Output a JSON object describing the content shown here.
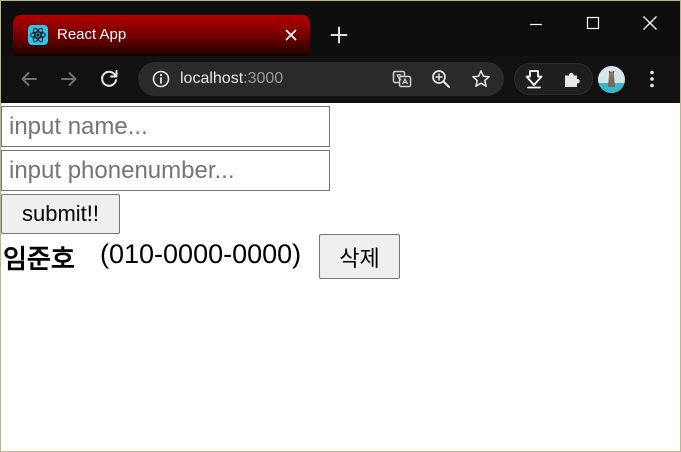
{
  "browser": {
    "tab": {
      "title": "React App",
      "favicon": "react-logo-icon"
    },
    "url": {
      "host": "localhost",
      "port": ":3000"
    },
    "accent": "#b30000",
    "toolbar_icons": [
      "back-arrow-icon",
      "forward-arrow-icon",
      "reload-icon",
      "site-info-icon",
      "translate-icon",
      "zoom-icon",
      "bookmark-star-icon",
      "extension-download-icon",
      "extensions-puzzle-icon",
      "profile-avatar",
      "more-menu-icon"
    ]
  },
  "form": {
    "name_placeholder": "input name...",
    "name_value": "",
    "phone_placeholder": "input phonenumber...",
    "phone_value": "",
    "submit_label": "submit!!"
  },
  "entries": [
    {
      "name": "임준호",
      "phone": "(010-0000-0000)",
      "delete_label": "삭제"
    }
  ]
}
